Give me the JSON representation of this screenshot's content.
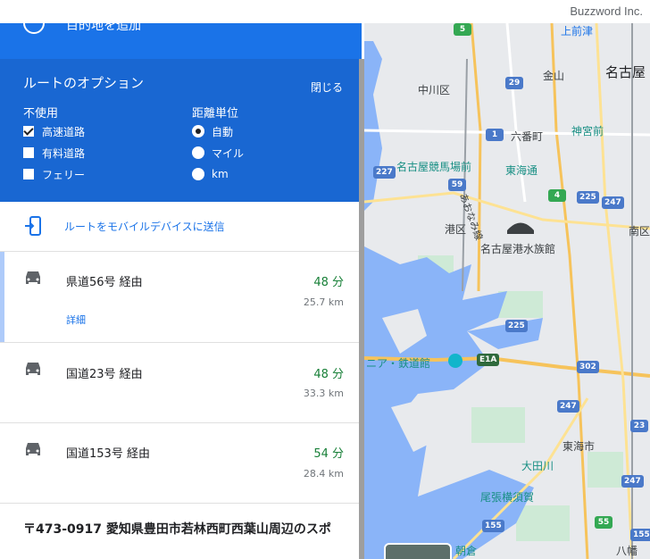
{
  "watermark": "Buzzword Inc.",
  "add_destination": "目的地を追加",
  "route_options": {
    "title": "ルートのオプション",
    "close": "閉じる",
    "avoid": {
      "heading": "不使用",
      "items": [
        {
          "label": "高速道路",
          "checked": true
        },
        {
          "label": "有料道路",
          "checked": false
        },
        {
          "label": "フェリー",
          "checked": false
        }
      ]
    },
    "units": {
      "heading": "距離単位",
      "items": [
        {
          "label": "自動",
          "selected": true
        },
        {
          "label": "マイル",
          "selected": false
        },
        {
          "label": "km",
          "selected": false
        }
      ]
    }
  },
  "send_to_mobile": "ルートをモバイルデバイスに送信",
  "routes": [
    {
      "via": "県道56号 経由",
      "time": "48 分",
      "distance": "25.7 km",
      "detail": "詳細"
    },
    {
      "via": "国道23号 経由",
      "time": "48 分",
      "distance": "33.3 km"
    },
    {
      "via": "国道153号 経由",
      "time": "54 分",
      "distance": "28.4 km"
    }
  ],
  "address": "〒473-0917 愛知県豊田市若林西町西葉山周辺のスポ",
  "map": {
    "labels": {
      "kamimaezu": "上前津",
      "kanayama": "金山",
      "nagoya": "名古屋",
      "nakagawa": "中川区",
      "rokubancho": "六番町",
      "jingumae": "神宮前",
      "keibajo": "名古屋競馬場前",
      "tokaidori": "東海通",
      "aonami": "あおなみ線",
      "minato": "港区",
      "aquarium": "名古屋港水族館",
      "minami": "南区",
      "railway": "ニア・鉄道館",
      "tokai": "東海市",
      "otagawa": "大田川",
      "owari": "尾張横須賀",
      "asakura": "朝倉",
      "yawata": "八幡"
    },
    "shields": [
      "5",
      "29",
      "1",
      "227",
      "59",
      "4",
      "225",
      "247",
      "225",
      "E1A",
      "302",
      "247",
      "23",
      "155",
      "55",
      "247",
      "155"
    ]
  },
  "colors": {
    "options_bg": "#1967d2",
    "add_bar_bg": "#1a73e8",
    "link_blue": "#1a73e8",
    "time_green": "#188038",
    "water": "#8ab4f8"
  }
}
